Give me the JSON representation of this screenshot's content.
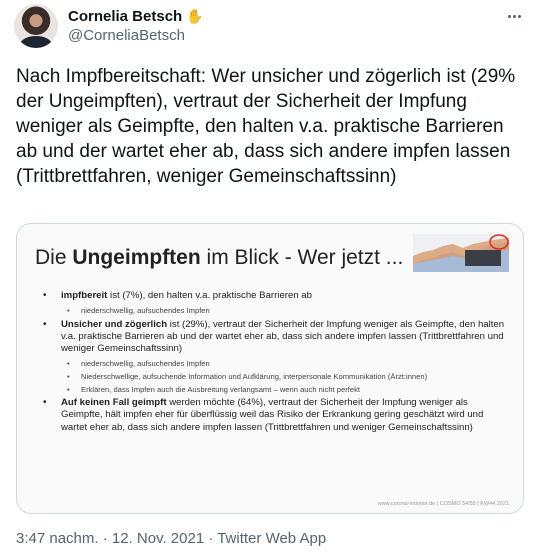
{
  "author": {
    "display_name": "Cornelia Betsch",
    "handle": "@CorneliaBetsch",
    "badge_icon": "waving-hand-icon"
  },
  "tweet": {
    "text": "Nach Impfbereitschaft: Wer unsicher und zögerlich ist (29% der Ungeimpften), vertraut der Sicherheit der Impfung weniger als Geimpfte, den halten v.a. praktische Barrieren ab und der wartet eher ab, dass sich andere impfen lassen (Trittbrettfahren, weniger Gemeinschaftssinn)"
  },
  "slide": {
    "title_prefix": "Die ",
    "title_bold": "Ungeimpften",
    "title_suffix": " im Blick - Wer jetzt ...",
    "items": [
      {
        "bold": "impfbereit",
        "text": " ist (7%), den halten v.a. praktische Barrieren ab",
        "subs": [
          "niederschwellig, aufsuchendes Impfen"
        ]
      },
      {
        "bold": "Unsicher und zögerlich",
        "text": " ist (29%), vertraut der Sicherheit der Impfung weniger als Geimpfte, den halten v.a. praktische Barrieren ab und der wartet eher ab, dass sich andere impfen lassen (Trittbrettfahren und weniger Gemeinschaftssinn)",
        "subs": [
          "niederschwellig, aufsuchendes Impfen",
          "Niederschwellige, aufsuchende Information und Aufklärung, interpersonale Kommunikation (Ärzt:innen)",
          "Erklären, dass Impfen auch die Ausbreitung verlangsamt – wenn auch nicht perfekt"
        ]
      },
      {
        "bold": "Auf keinen Fall geimpft",
        "text": " werden möchte (64%), vertraut der Sicherheit der Impfung weniger als Geimpfte, hält impfen eher für überflüssig weil das Risiko der Erkrankung gering geschätzt wird und wartet eher ab, dass sich andere impfen lassen (Trittbrettfahren und weniger Gemeinschaftssinn)",
        "subs": []
      }
    ],
    "footer": "www.corona-monitor.de | COSMO 54/55 | KW44 2021"
  },
  "meta": {
    "timestamp": "3:47 nachm. · 12. Nov. 2021 · Twitter Web App"
  },
  "colors": {
    "text": "#0f1419",
    "secondary": "#536471",
    "border": "#cfd9de",
    "highlight_circle": "#e0301e"
  }
}
